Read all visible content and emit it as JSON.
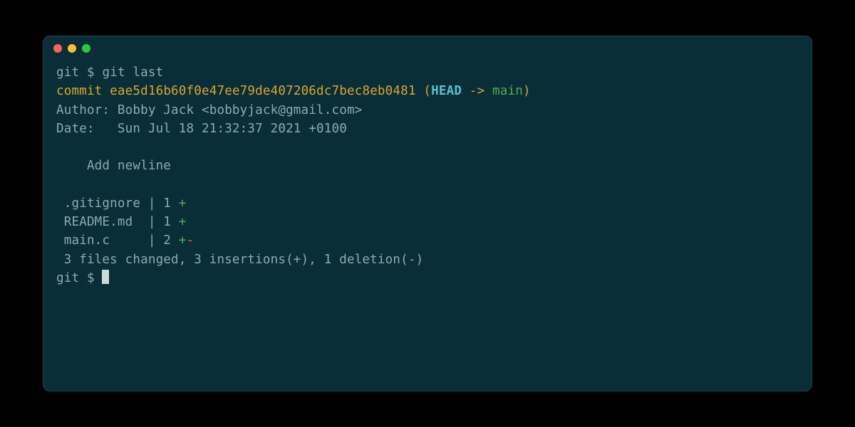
{
  "terminal": {
    "prompt1": {
      "dir": "git",
      "symbol": "$",
      "command": "git last"
    },
    "commit": {
      "label": "commit",
      "hash": "eae5d16b60f0e47ee79de407206dc7bec8eb0481",
      "paren_open": "(",
      "head": "HEAD",
      "arrow": " -> ",
      "branch": "main",
      "paren_close": ")"
    },
    "author_line": "Author: Bobby Jack <bobbyjack@gmail.com>",
    "date_line": "Date:   Sun Jul 18 21:32:37 2021 +0100",
    "message": "    Add newline",
    "files": [
      {
        "name": " .gitignore | 1 ",
        "plus": "+",
        "minus": ""
      },
      {
        "name": " README.md  | 1 ",
        "plus": "+",
        "minus": ""
      },
      {
        "name": " main.c     | 2 ",
        "plus": "+",
        "minus": "-"
      }
    ],
    "summary": " 3 files changed, 3 insertions(+), 1 deletion(-)",
    "prompt2": {
      "dir": "git",
      "symbol": "$"
    }
  },
  "colors": {
    "bg": "#0a2e38",
    "text": "#8ea9b0",
    "yellow": "#d9a52e",
    "cyan": "#5bc0cc",
    "green": "#4caf50",
    "red": "#e05561"
  }
}
